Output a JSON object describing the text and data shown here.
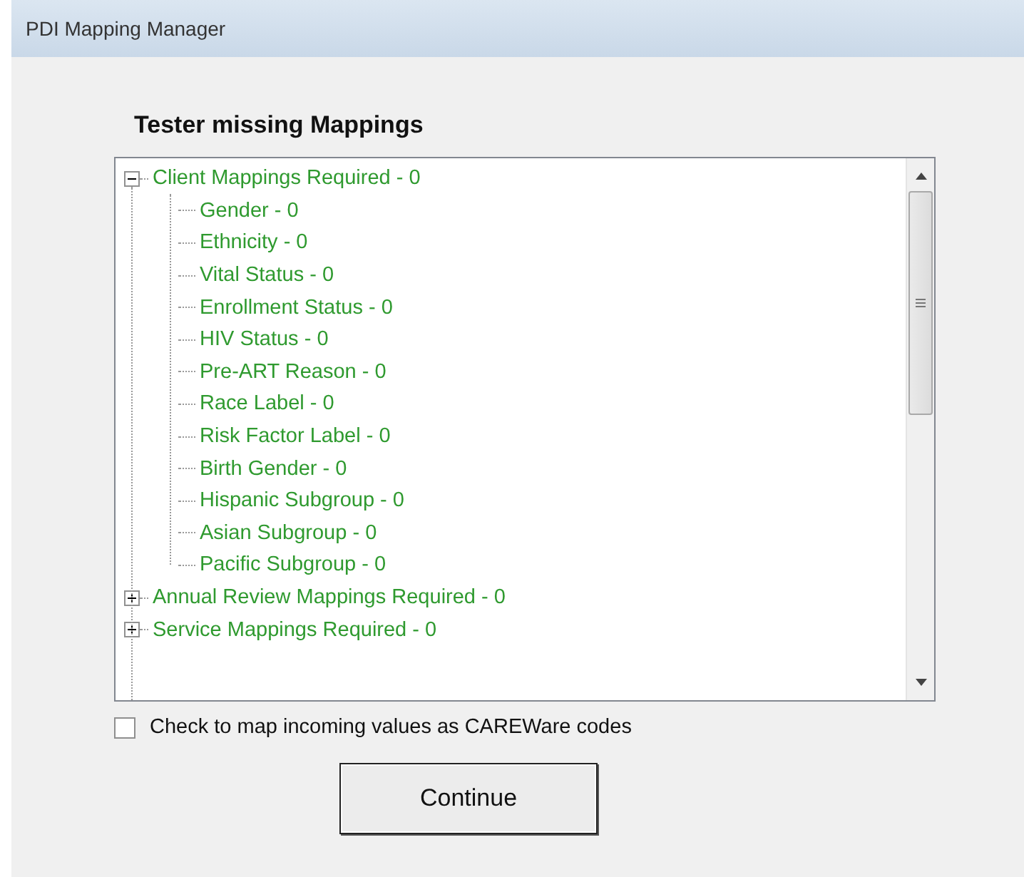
{
  "window": {
    "title": "PDI Mapping Manager"
  },
  "heading": "Tester missing Mappings",
  "tree": {
    "items": [
      {
        "label": "Client Mappings Required - 0",
        "expanded": true,
        "children": [
          {
            "label": "Gender - 0"
          },
          {
            "label": "Ethnicity - 0"
          },
          {
            "label": "Vital Status - 0"
          },
          {
            "label": "Enrollment Status - 0"
          },
          {
            "label": "HIV Status - 0"
          },
          {
            "label": "Pre-ART Reason - 0"
          },
          {
            "label": "Race Label - 0"
          },
          {
            "label": "Risk Factor Label - 0"
          },
          {
            "label": "Birth Gender - 0"
          },
          {
            "label": "Hispanic Subgroup - 0"
          },
          {
            "label": "Asian Subgroup - 0"
          },
          {
            "label": "Pacific Subgroup - 0"
          }
        ]
      },
      {
        "label": "Annual Review Mappings Required - 0",
        "expanded": false
      },
      {
        "label": "Service Mappings Required - 0",
        "expanded": false
      }
    ]
  },
  "checkbox": {
    "label": "Check to map incoming values as CAREWare codes",
    "checked": false
  },
  "buttons": [
    "Continue"
  ]
}
